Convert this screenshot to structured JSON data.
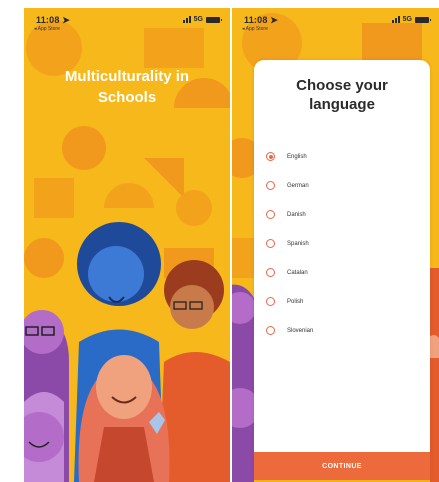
{
  "status_bar": {
    "time": "11:08",
    "back_label": "◂ App Store",
    "network": "5G"
  },
  "splash": {
    "title_line1": "Multiculturality in",
    "title_line2": "Schools"
  },
  "language_dialog": {
    "title_line1": "Choose your",
    "title_line2": "language",
    "options": [
      {
        "label": "English",
        "selected": true
      },
      {
        "label": "German",
        "selected": false
      },
      {
        "label": "Danish",
        "selected": false
      },
      {
        "label": "Spanish",
        "selected": false
      },
      {
        "label": "Catalan",
        "selected": false
      },
      {
        "label": "Polish",
        "selected": false
      },
      {
        "label": "Slovenian",
        "selected": false
      }
    ],
    "continue_label": "CONTINUE"
  },
  "colors": {
    "background_yellow": "#f6b81a",
    "pattern_orange": "#f0991c",
    "accent_orange": "#ec6a3c",
    "radio_orange": "#e8674a",
    "card_white": "#ffffff"
  },
  "icons": [
    "location-arrow-icon",
    "signal-icon",
    "battery-icon",
    "radio-icon"
  ]
}
